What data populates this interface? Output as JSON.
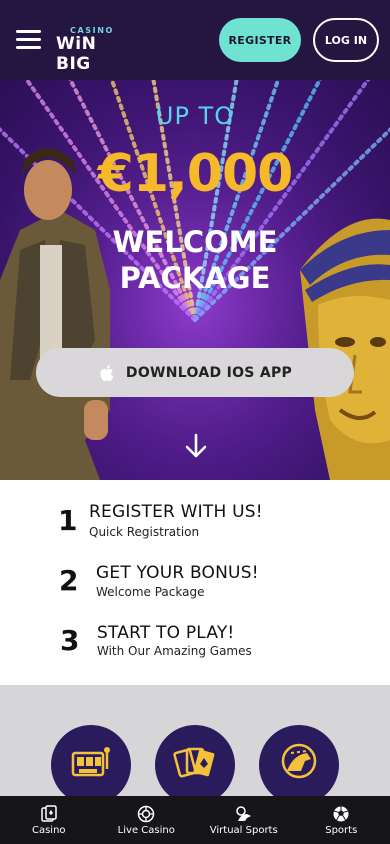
{
  "header": {
    "logo_small": "CASINO",
    "logo_main": "WiN BIG",
    "register_label": "REGISTER",
    "login_label": "LOG IN",
    "menu_icon": "hamburger-icon"
  },
  "hero": {
    "up_to": "UP TO",
    "amount": "€1,000",
    "welcome_line1": "WELCOME",
    "welcome_line2": "PACKAGE",
    "download_label": "DOWNLOAD IOS APP",
    "download_icon": "apple-icon",
    "scroll_icon": "arrow-down-icon"
  },
  "steps": [
    {
      "num": "1",
      "title": "REGISTER WITH US!",
      "sub": "Quick Registration"
    },
    {
      "num": "2",
      "title": "GET YOUR BONUS!",
      "sub": "Welcome Package"
    },
    {
      "num": "3",
      "title": "START TO PLAY!",
      "sub": "With Our Amazing Games"
    }
  ],
  "categories": [
    {
      "icon": "slot-machine-icon"
    },
    {
      "icon": "playing-cards-icon"
    },
    {
      "icon": "horse-racing-icon"
    }
  ],
  "nav": [
    {
      "label": "Casino",
      "icon": "cards-icon"
    },
    {
      "label": "Live Casino",
      "icon": "roulette-icon"
    },
    {
      "label": "Virtual Sports",
      "icon": "virtual-sports-icon"
    },
    {
      "label": "Sports",
      "icon": "soccer-ball-icon"
    }
  ],
  "colors": {
    "header_bg": "#241640",
    "register_bg": "#6fe3d2",
    "amount": "#f6b92a",
    "up_to": "#56d4e8",
    "nav_bg": "#161519"
  }
}
